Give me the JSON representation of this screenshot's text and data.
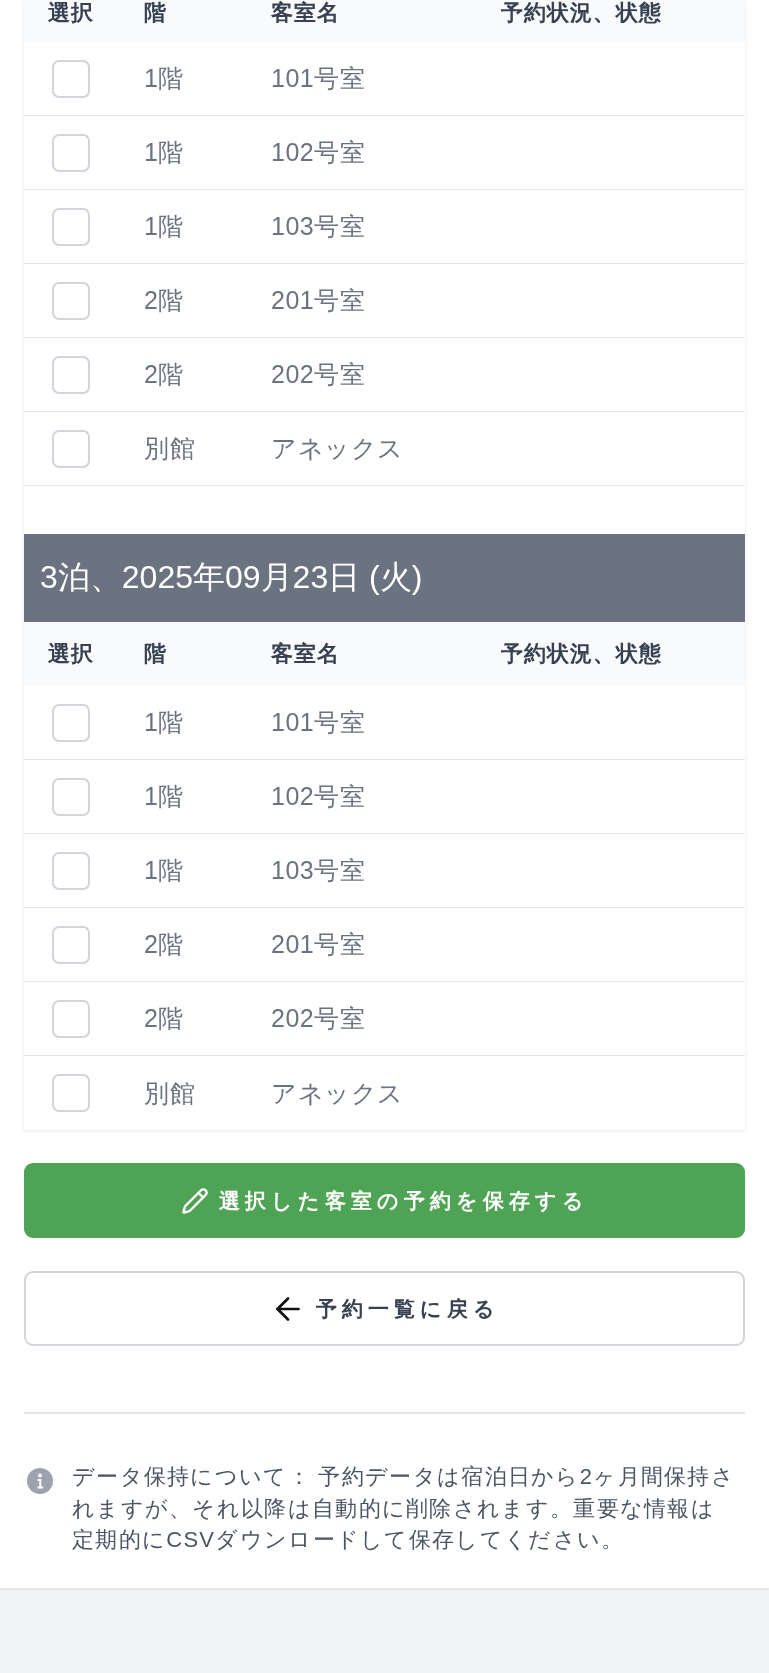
{
  "sections": [
    {
      "columns": [
        "選択",
        "階",
        "客室名",
        "予約状況、状態"
      ],
      "rows": [
        {
          "floor": "1階",
          "room": "101号室",
          "checked": false
        },
        {
          "floor": "1階",
          "room": "102号室",
          "checked": false
        },
        {
          "floor": "1階",
          "room": "103号室",
          "checked": false
        },
        {
          "floor": "2階",
          "room": "201号室",
          "checked": false
        },
        {
          "floor": "2階",
          "room": "202号室",
          "checked": false
        },
        {
          "floor": "別館",
          "room": "アネックス",
          "checked": false
        }
      ]
    },
    {
      "title": "3泊、2025年09月23日 (火)",
      "columns": [
        "選択",
        "階",
        "客室名",
        "予約状況、状態"
      ],
      "rows": [
        {
          "floor": "1階",
          "room": "101号室",
          "checked": false
        },
        {
          "floor": "1階",
          "room": "102号室",
          "checked": false
        },
        {
          "floor": "1階",
          "room": "103号室",
          "checked": false
        },
        {
          "floor": "2階",
          "room": "201号室",
          "checked": false
        },
        {
          "floor": "2階",
          "room": "202号室",
          "checked": false
        },
        {
          "floor": "別館",
          "room": "アネックス",
          "checked": false
        }
      ]
    }
  ],
  "buttons": [
    {
      "kind": "primary",
      "label": "選択した客室の予約を保存する"
    },
    {
      "kind": "back",
      "label": "予約一覧に戻る"
    }
  ],
  "notice": {
    "text": "データ保持について： 予約データは宿泊日から2ヶ月間保持されますが、それ以降は自動的に削除されます。重要な情報は定期的にCSVダウンロードして保存してください。"
  }
}
